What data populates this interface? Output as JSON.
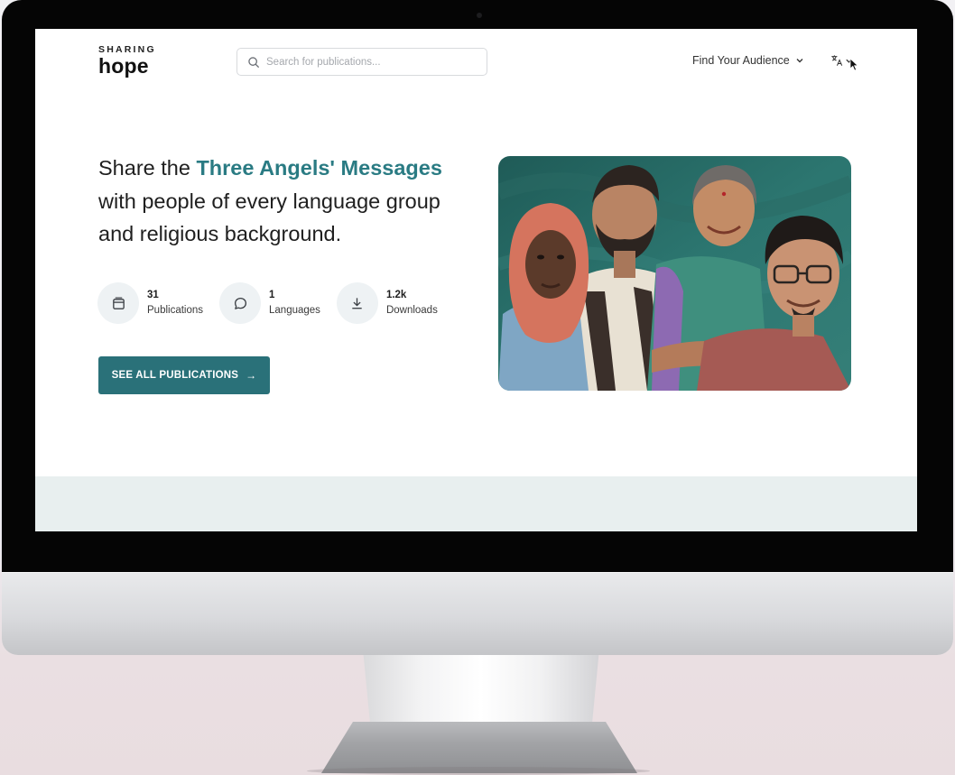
{
  "header": {
    "logo_small": "SHARING",
    "logo_big": "hope",
    "search_placeholder": "Search for publications...",
    "nav_audience": "Find Your Audience"
  },
  "hero": {
    "headline_pre": "Share the ",
    "headline_accent": "Three Angels' Messages",
    "headline_post": " with people of every language group and religious background.",
    "accent_color": "#2a7b83"
  },
  "stats": [
    {
      "value": "31",
      "label": "Publications",
      "icon": "publications-icon"
    },
    {
      "value": "1",
      "label": "Languages",
      "icon": "chat-bubble-icon"
    },
    {
      "value": "1.2k",
      "label": "Downloads",
      "icon": "download-icon"
    }
  ],
  "cta": {
    "label": "SEE ALL PUBLICATIONS",
    "arrow": "→",
    "color": "#2a7179"
  },
  "hero_image": {
    "icon": "people-illustration"
  }
}
